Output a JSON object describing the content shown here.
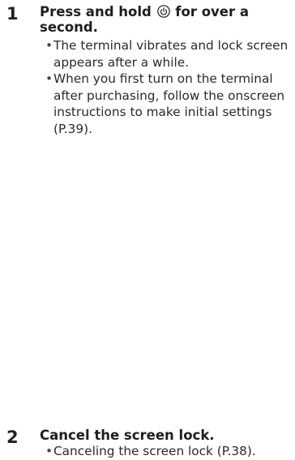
{
  "steps": [
    {
      "number": "1",
      "title_before": "Press and hold",
      "title_icon": "power-icon",
      "title_after": "for over a second.",
      "bullets": [
        "The terminal vibrates and lock screen appears after a while.",
        "When you first turn on the terminal after purchasing, follow the onscreen instructions to make initial settings (P.39)."
      ]
    },
    {
      "number": "2",
      "title": "Cancel the screen lock.",
      "bullets": [
        "Canceling the screen lock (P.38)."
      ]
    }
  ]
}
